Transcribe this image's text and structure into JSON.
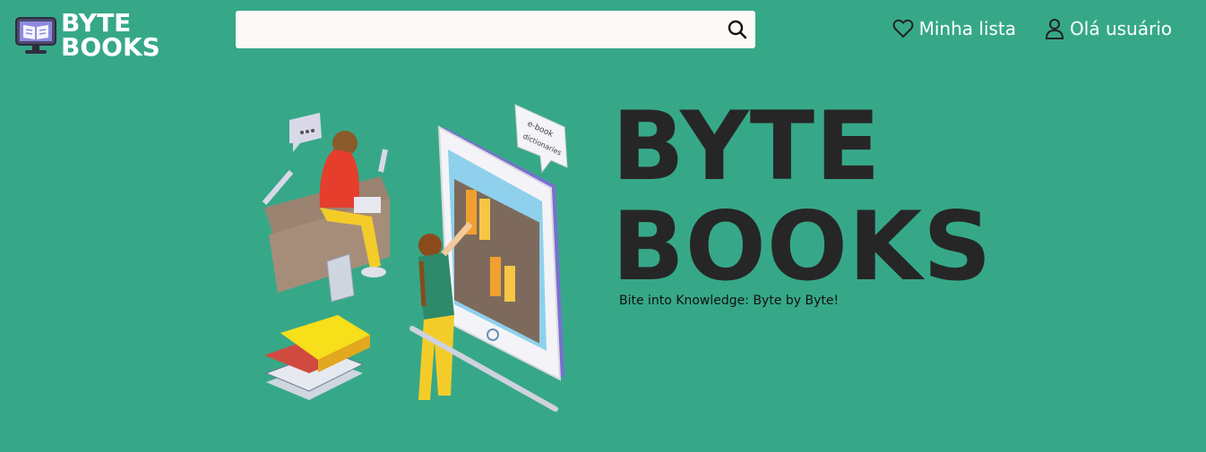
{
  "header": {
    "logo": {
      "line1": "BYTE",
      "line2": "BOOKS",
      "icon": "monitor-book-icon"
    },
    "search": {
      "placeholder": "",
      "value": "",
      "icon": "search-icon"
    },
    "nav": [
      {
        "label": "Minha lista",
        "icon": "heart-icon"
      },
      {
        "label": "Olá usuário",
        "icon": "user-icon"
      }
    ]
  },
  "hero": {
    "title_line1": "BYTE",
    "title_line2": "BOOKS",
    "tagline": "Bite into Knowledge: Byte by Byte!",
    "illustration": {
      "bubble_text_1": "e-book",
      "bubble_text_2": "dictionaries"
    }
  },
  "colors": {
    "background": "#36a888",
    "title": "#262626",
    "accent": "#ffffff"
  }
}
